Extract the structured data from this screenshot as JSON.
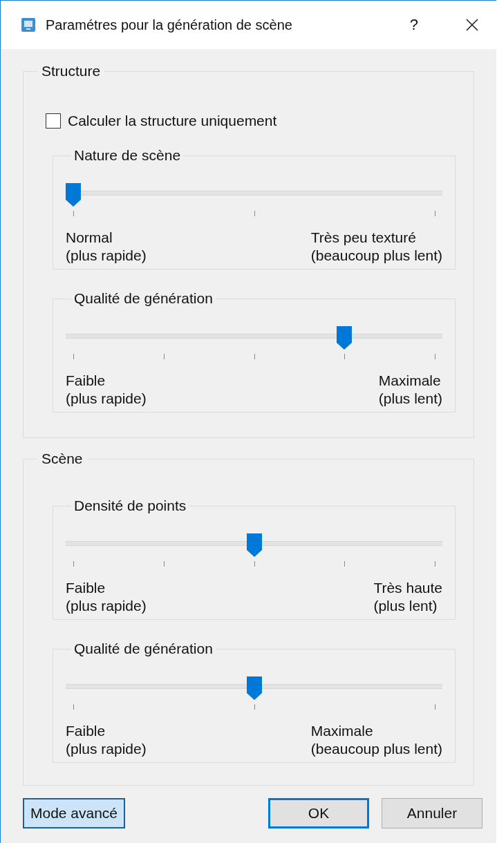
{
  "window": {
    "title": "Paramétres pour la génération de scène",
    "help": "?"
  },
  "groups": [
    {
      "title": "Structure",
      "checkbox": {
        "label": "Calculer la structure uniquement",
        "checked": false
      },
      "sliders": [
        {
          "title": "Nature de scène",
          "kind": "three-step",
          "level": 0,
          "min_label": "Normal\n(plus rapide)",
          "max_label": "Très peu texturé\n(beaucoup plus lent)"
        },
        {
          "title": "Qualité de génération",
          "kind": "five-step",
          "level": 0.75,
          "min_label": "Faible\n(plus rapide)",
          "max_label": "Maximale\n(plus lent)"
        }
      ]
    },
    {
      "title": "Scène",
      "sliders": [
        {
          "title": "Densité de points",
          "kind": "five-step",
          "level": 0.5,
          "min_label": "Faible\n(plus rapide)",
          "max_label": "Très haute\n(plus lent)"
        },
        {
          "title": "Qualité de génération",
          "kind": "three-step",
          "level": 0.5,
          "min_label": "Faible\n(plus rapide)",
          "max_label": "Maximale\n(beaucoup plus lent)"
        }
      ]
    }
  ],
  "buttons": [
    {
      "label": "Mode avancé",
      "kind": "highlighted"
    },
    {
      "label": "OK",
      "kind": "default"
    },
    {
      "label": "Annuler",
      "kind": "normal"
    }
  ]
}
